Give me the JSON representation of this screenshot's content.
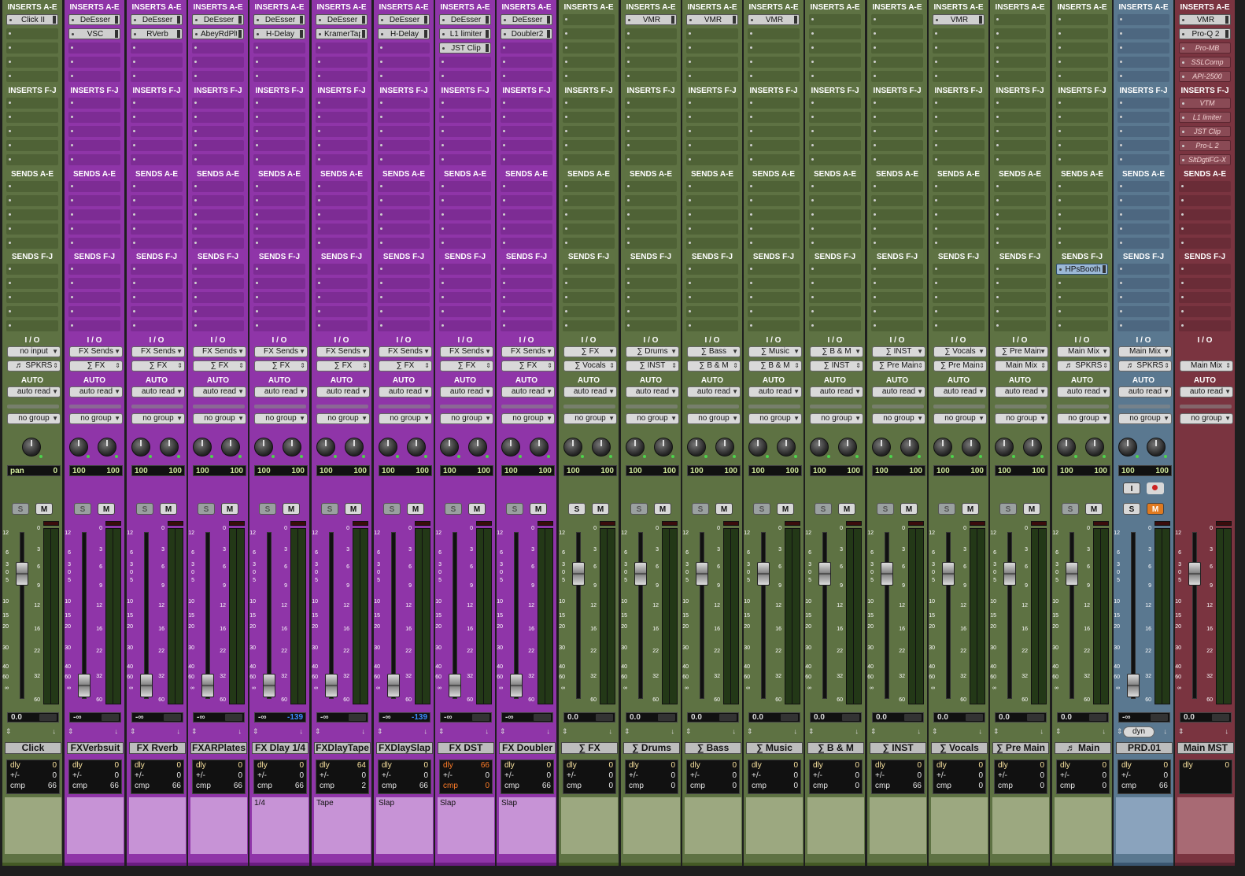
{
  "sections": {
    "inserts_ae": "INSERTS A-E",
    "inserts_fj": "INSERTS F-J",
    "sends_ae": "SENDS A-E",
    "sends_fj": "SENDS F-J",
    "io": "I / O",
    "auto": "AUTO"
  },
  "colors": {
    "green": "#5e7243",
    "purple": "#8f35a8",
    "blue": "#5a7890",
    "red": "#7a3440",
    "pan_text": "#cfe89a",
    "blue_peak": "#3b8cff",
    "highlight": "#ff7d28"
  },
  "fader_scale": [
    "12",
    "6",
    "3",
    "0",
    "5",
    "10",
    "15",
    "20",
    "30",
    "40",
    "60",
    "∞"
  ],
  "meter_scale": [
    "0",
    "3",
    "6",
    "9",
    "12",
    "16",
    "22",
    "32",
    "60"
  ],
  "strips": [
    {
      "name": "Click",
      "color": "green",
      "ins_ae": [
        "Click II",
        "",
        "",
        "",
        ""
      ],
      "ins_fj": [
        "",
        "",
        "",
        "",
        ""
      ],
      "sends_fj": [
        "",
        "",
        "",
        "",
        ""
      ],
      "input": "no input",
      "output": "♬ SPKRS",
      "auto": "auto read",
      "group": "no group",
      "mono": true,
      "pan_label": "pan",
      "pan_val": "0",
      "pan_l": "",
      "pan_r": "",
      "vol": "0.0",
      "vol_color": "",
      "dly": "0",
      "pm": "0",
      "cmp": "66",
      "cmp_hl": false,
      "dly_hl": false,
      "comment": ""
    },
    {
      "name": "FXVerbsuit",
      "color": "purple",
      "ins_ae": [
        "DeEsser",
        "VSC",
        "",
        "",
        ""
      ],
      "ins_fj": [
        "",
        "",
        "",
        "",
        ""
      ],
      "sends_fj": [
        "",
        "",
        "",
        "",
        ""
      ],
      "input": "FX Sends",
      "output": "∑ FX",
      "auto": "auto read",
      "group": "no group",
      "mono": false,
      "pan_l": "100",
      "pan_r": "100",
      "vol": "-∞",
      "vol_color": "",
      "dly": "0",
      "pm": "0",
      "cmp": "66",
      "cmp_hl": false,
      "dly_hl": false,
      "comment": ""
    },
    {
      "name": "FX Rverb",
      "color": "purple",
      "ins_ae": [
        "DeEsser",
        "RVerb",
        "",
        "",
        ""
      ],
      "ins_fj": [
        "",
        "",
        "",
        "",
        ""
      ],
      "sends_fj": [
        "",
        "",
        "",
        "",
        ""
      ],
      "input": "FX Sends",
      "output": "∑ FX",
      "auto": "auto read",
      "group": "no group",
      "mono": false,
      "pan_l": "100",
      "pan_r": "100",
      "vol": "-∞",
      "vol_color": "",
      "dly": "0",
      "pm": "0",
      "cmp": "66",
      "cmp_hl": false,
      "dly_hl": false,
      "comment": ""
    },
    {
      "name": "FXARPlates",
      "color": "purple",
      "ins_ae": [
        "DeEsser",
        "AbeyRdPlts",
        "",
        "",
        ""
      ],
      "ins_fj": [
        "",
        "",
        "",
        "",
        ""
      ],
      "sends_fj": [
        "",
        "",
        "",
        "",
        ""
      ],
      "input": "FX Sends",
      "output": "∑ FX",
      "auto": "auto read",
      "group": "no group",
      "mono": false,
      "pan_l": "100",
      "pan_r": "100",
      "vol": "-∞",
      "vol_color": "",
      "dly": "0",
      "pm": "0",
      "cmp": "66",
      "cmp_hl": false,
      "dly_hl": false,
      "comment": ""
    },
    {
      "name": "FX Dlay 1/4",
      "color": "purple",
      "ins_ae": [
        "DeEsser",
        "H-Delay",
        "",
        "",
        ""
      ],
      "ins_fj": [
        "",
        "",
        "",
        "",
        ""
      ],
      "sends_fj": [
        "",
        "",
        "",
        "",
        ""
      ],
      "input": "FX Sends",
      "output": "∑ FX",
      "auto": "auto read",
      "group": "no group",
      "mono": false,
      "pan_l": "100",
      "pan_r": "100",
      "vol": "-∞",
      "peak": "-139",
      "vol_color": "",
      "dly": "0",
      "pm": "0",
      "cmp": "66",
      "cmp_hl": false,
      "dly_hl": false,
      "comment": "1/4"
    },
    {
      "name": "FXDlayTape",
      "color": "purple",
      "ins_ae": [
        "DeEsser",
        "KramerTape",
        "",
        "",
        ""
      ],
      "ins_fj": [
        "",
        "",
        "",
        "",
        ""
      ],
      "sends_fj": [
        "",
        "",
        "",
        "",
        ""
      ],
      "input": "FX Sends",
      "output": "∑ FX",
      "auto": "auto read",
      "group": "no group",
      "mono": false,
      "pan_l": "100",
      "pan_r": "100",
      "vol": "-∞",
      "vol_color": "",
      "dly": "64",
      "pm": "0",
      "cmp": "2",
      "cmp_hl": false,
      "dly_hl": false,
      "comment": "Tape"
    },
    {
      "name": "FXDlaySlap",
      "color": "purple",
      "ins_ae": [
        "DeEsser",
        "H-Delay",
        "",
        "",
        ""
      ],
      "ins_fj": [
        "",
        "",
        "",
        "",
        ""
      ],
      "sends_fj": [
        "",
        "",
        "",
        "",
        ""
      ],
      "input": "FX Sends",
      "output": "∑ FX",
      "auto": "auto read",
      "group": "no group",
      "mono": false,
      "pan_l": "100",
      "pan_r": "100",
      "vol": "-∞",
      "peak": "-139",
      "vol_color": "",
      "dly": "0",
      "pm": "0",
      "cmp": "66",
      "cmp_hl": false,
      "dly_hl": false,
      "comment": "Slap"
    },
    {
      "name": "FX DST",
      "color": "purple",
      "ins_ae": [
        "DeEsser",
        "L1 limiter",
        "JST Clip",
        "",
        ""
      ],
      "ins_fj": [
        "",
        "",
        "",
        "",
        ""
      ],
      "sends_fj": [
        "",
        "",
        "",
        "",
        ""
      ],
      "input": "FX Sends",
      "output": "∑ FX",
      "auto": "auto read",
      "group": "no group",
      "mono": false,
      "pan_l": "100",
      "pan_r": "100",
      "vol": "-∞",
      "vol_color": "",
      "dly": "66",
      "pm": "0",
      "cmp": "0",
      "cmp_hl": true,
      "dly_hl": true,
      "comment": "Slap"
    },
    {
      "name": "FX Doubler",
      "color": "purple",
      "ins_ae": [
        "DeEsser",
        "Doubler2",
        "",
        "",
        ""
      ],
      "ins_fj": [
        "",
        "",
        "",
        "",
        ""
      ],
      "sends_fj": [
        "",
        "",
        "",
        "",
        ""
      ],
      "input": "FX Sends",
      "output": "∑ FX",
      "auto": "auto read",
      "group": "no group",
      "mono": false,
      "pan_l": "100",
      "pan_r": "100",
      "vol": "-∞",
      "vol_color": "",
      "dly": "0",
      "pm": "0",
      "cmp": "66",
      "cmp_hl": false,
      "dly_hl": false,
      "comment": "Slap"
    },
    {
      "name": "∑ FX",
      "color": "green",
      "ins_ae": [
        "",
        "",
        "",
        "",
        ""
      ],
      "ins_fj": [
        "",
        "",
        "",
        "",
        ""
      ],
      "sends_fj": [
        "",
        "",
        "",
        "",
        ""
      ],
      "input": "∑ FX",
      "output": "∑ Vocals",
      "auto": "auto read",
      "group": "no group",
      "mono": false,
      "pan_l": "100",
      "pan_r": "100",
      "vol": "0.0",
      "vol_color": "",
      "dly": "0",
      "pm": "0",
      "cmp": "0",
      "cmp_hl": false,
      "dly_hl": false,
      "comment": "",
      "solo_active": true
    },
    {
      "name": "∑ Drums",
      "color": "green",
      "ins_ae": [
        "VMR",
        "",
        "",
        "",
        ""
      ],
      "ins_fj": [
        "",
        "",
        "",
        "",
        ""
      ],
      "sends_fj": [
        "",
        "",
        "",
        "",
        ""
      ],
      "input": "∑ Drums",
      "output": "∑ INST",
      "auto": "auto read",
      "group": "no group",
      "mono": false,
      "pan_l": "100",
      "pan_r": "100",
      "vol": "0.0",
      "vol_color": "",
      "dly": "0",
      "pm": "0",
      "cmp": "0",
      "cmp_hl": false,
      "dly_hl": false,
      "comment": ""
    },
    {
      "name": "∑ Bass",
      "color": "green",
      "ins_ae": [
        "VMR",
        "",
        "",
        "",
        ""
      ],
      "ins_fj": [
        "",
        "",
        "",
        "",
        ""
      ],
      "sends_fj": [
        "",
        "",
        "",
        "",
        ""
      ],
      "input": "∑ Bass",
      "output": "∑ B & M",
      "auto": "auto read",
      "group": "no group",
      "mono": false,
      "pan_l": "100",
      "pan_r": "100",
      "vol": "0.0",
      "vol_color": "",
      "dly": "0",
      "pm": "0",
      "cmp": "0",
      "cmp_hl": false,
      "dly_hl": false,
      "comment": ""
    },
    {
      "name": "∑ Music",
      "color": "green",
      "ins_ae": [
        "VMR",
        "",
        "",
        "",
        ""
      ],
      "ins_fj": [
        "",
        "",
        "",
        "",
        ""
      ],
      "sends_fj": [
        "",
        "",
        "",
        "",
        ""
      ],
      "input": "∑ Music",
      "output": "∑ B & M",
      "auto": "auto read",
      "group": "no group",
      "mono": false,
      "pan_l": "100",
      "pan_r": "100",
      "vol": "0.0",
      "vol_color": "",
      "dly": "0",
      "pm": "0",
      "cmp": "0",
      "cmp_hl": false,
      "dly_hl": false,
      "comment": ""
    },
    {
      "name": "∑ B & M",
      "color": "green",
      "ins_ae": [
        "",
        "",
        "",
        "",
        ""
      ],
      "ins_fj": [
        "",
        "",
        "",
        "",
        ""
      ],
      "sends_fj": [
        "",
        "",
        "",
        "",
        ""
      ],
      "input": "∑ B & M",
      "output": "∑ INST",
      "auto": "auto read",
      "group": "no group",
      "mono": false,
      "pan_l": "100",
      "pan_r": "100",
      "vol": "0.0",
      "vol_color": "",
      "dly": "0",
      "pm": "0",
      "cmp": "0",
      "cmp_hl": false,
      "dly_hl": false,
      "comment": ""
    },
    {
      "name": "∑ INST",
      "color": "green",
      "ins_ae": [
        "",
        "",
        "",
        "",
        ""
      ],
      "ins_fj": [
        "",
        "",
        "",
        "",
        ""
      ],
      "sends_fj": [
        "",
        "",
        "",
        "",
        ""
      ],
      "input": "∑ INST",
      "output": "∑ Pre Main",
      "auto": "auto read",
      "group": "no group",
      "mono": false,
      "pan_l": "100",
      "pan_r": "100",
      "vol": "0.0",
      "vol_color": "",
      "dly": "0",
      "pm": "0",
      "cmp": "66",
      "cmp_hl": false,
      "dly_hl": false,
      "comment": ""
    },
    {
      "name": "∑ Vocals",
      "color": "green",
      "ins_ae": [
        "VMR",
        "",
        "",
        "",
        ""
      ],
      "ins_fj": [
        "",
        "",
        "",
        "",
        ""
      ],
      "sends_fj": [
        "",
        "",
        "",
        "",
        ""
      ],
      "input": "∑ Vocals",
      "output": "∑ Pre Main",
      "auto": "auto read",
      "group": "no group",
      "mono": false,
      "pan_l": "100",
      "pan_r": "100",
      "vol": "0.0",
      "vol_color": "",
      "dly": "0",
      "pm": "0",
      "cmp": "0",
      "cmp_hl": false,
      "dly_hl": false,
      "comment": ""
    },
    {
      "name": "∑ Pre Main",
      "color": "green",
      "ins_ae": [
        "",
        "",
        "",
        "",
        ""
      ],
      "ins_fj": [
        "",
        "",
        "",
        "",
        ""
      ],
      "sends_fj": [
        "",
        "",
        "",
        "",
        ""
      ],
      "input": "∑ Pre Main",
      "output": "Main Mix",
      "auto": "auto read",
      "group": "no group",
      "mono": false,
      "pan_l": "100",
      "pan_r": "100",
      "vol": "0.0",
      "vol_color": "",
      "dly": "0",
      "pm": "0",
      "cmp": "0",
      "cmp_hl": false,
      "dly_hl": false,
      "comment": ""
    },
    {
      "name": "♬ Main",
      "color": "green",
      "ins_ae": [
        "",
        "",
        "",
        "",
        ""
      ],
      "ins_fj": [
        "",
        "",
        "",
        "",
        ""
      ],
      "sends_fj": [
        "HPsBooth",
        "",
        "",
        "",
        ""
      ],
      "input": "Main Mix",
      "output": "♬ SPKRS",
      "auto": "auto read",
      "group": "no group",
      "mono": false,
      "pan_l": "100",
      "pan_r": "100",
      "vol": "0.0",
      "vol_color": "",
      "dly": "0",
      "pm": "0",
      "cmp": "0",
      "cmp_hl": false,
      "dly_hl": false,
      "comment": ""
    },
    {
      "name": "PRD.01",
      "color": "blue",
      "ins_ae": [
        "",
        "",
        "",
        "",
        ""
      ],
      "ins_fj": [
        "",
        "",
        "",
        "",
        ""
      ],
      "sends_fj": [
        "",
        "",
        "",
        "",
        ""
      ],
      "input": "Main Mix",
      "output": "♬ SPKRS",
      "auto": "auto read",
      "group": "no group",
      "mono": false,
      "pan_l": "100",
      "pan_r": "100",
      "vol": "-∞",
      "vol_color": "",
      "dly": "0",
      "pm": "0",
      "cmp": "66",
      "cmp_hl": false,
      "dly_hl": false,
      "comment": "",
      "rec_track": true,
      "dyn_label": "dyn",
      "input_btn": "I"
    },
    {
      "name": "Main MST",
      "color": "red",
      "ins_ae": [
        "VMR",
        "Pro-Q 2",
        "Pro-MB",
        "SSLComp",
        "API-2500"
      ],
      "ins_fj": [
        "VTM",
        "L1 limiter",
        "JST Clip",
        "Pro-L 2",
        "SltDgtlFG-X"
      ],
      "sends_fj": [
        "",
        "",
        "",
        "",
        ""
      ],
      "input": "",
      "output": "Main Mix",
      "auto": "auto read",
      "group": "no group",
      "master": true,
      "mono": true,
      "vol": "0.0",
      "vol_color": "",
      "dly": "0",
      "comment": ""
    }
  ]
}
